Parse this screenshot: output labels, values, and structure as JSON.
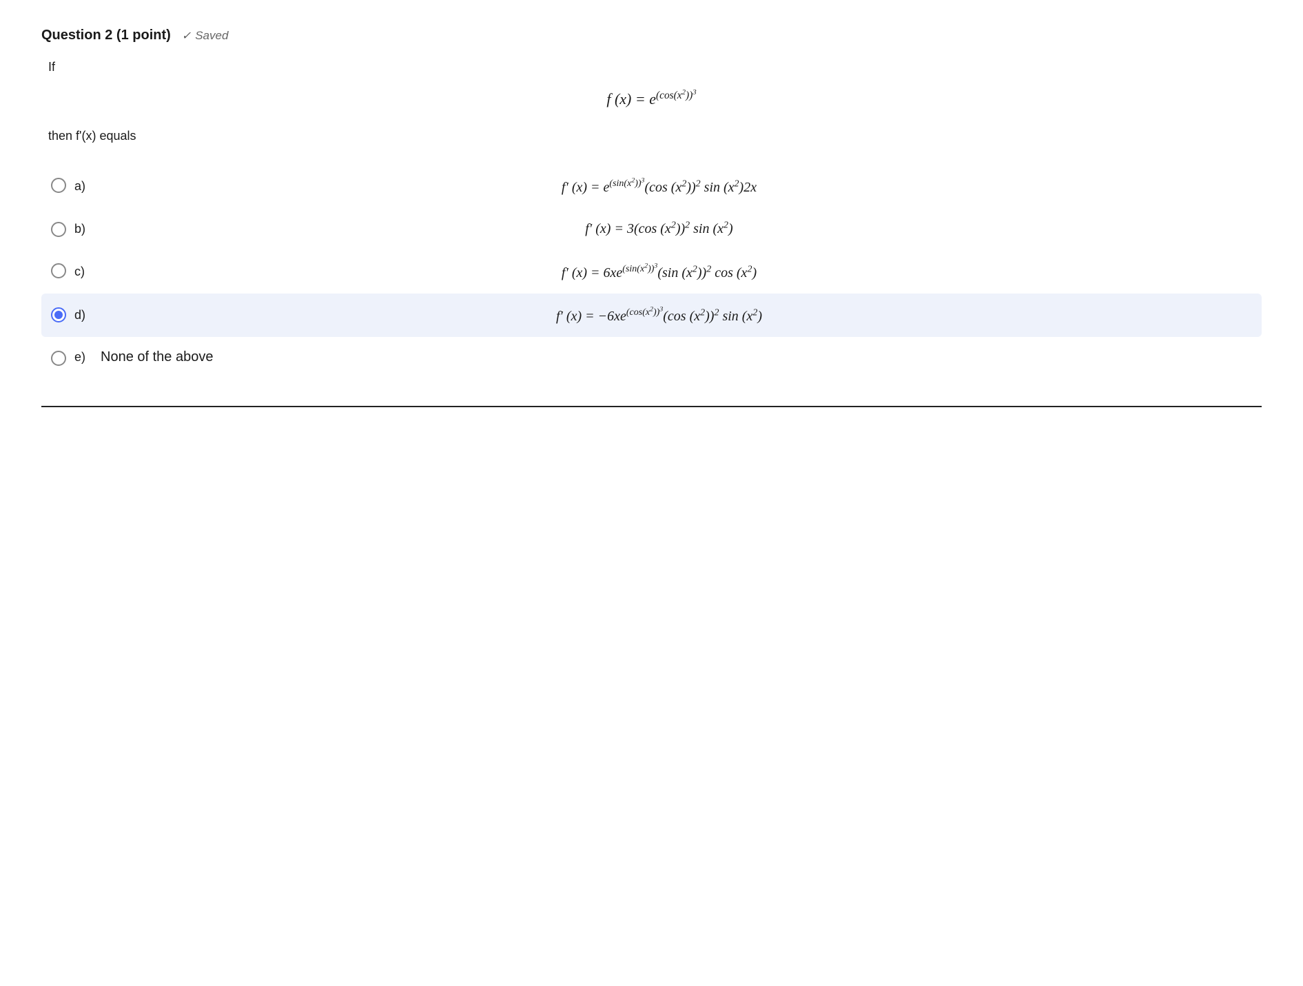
{
  "header": {
    "question_number": "Question 2",
    "points": "(1 point)",
    "saved_label": "Saved"
  },
  "question": {
    "if_text": "If",
    "then_text": "then f'(x) equals",
    "main_formula": "f(x) = e^((cos(x²))³)"
  },
  "options": [
    {
      "id": "a",
      "label": "a)",
      "formula": "f′(x) = e^((sin(x²))³) · (cos(x²))² · sin(x²) · 2x",
      "selected": false
    },
    {
      "id": "b",
      "label": "b)",
      "formula": "f′(x) = 3(cos(x²))² sin(x²)",
      "selected": false
    },
    {
      "id": "c",
      "label": "c)",
      "formula": "f′(x) = 6xe^((sin(x²))³) · (sin(x²))² · cos(x²)",
      "selected": false
    },
    {
      "id": "d",
      "label": "d)",
      "formula": "f′(x) = −6xe^((cos(x²))³) · (cos(x²))² · sin(x²)",
      "selected": true
    },
    {
      "id": "e",
      "label": "e)",
      "formula": "None of the above",
      "selected": false
    }
  ]
}
